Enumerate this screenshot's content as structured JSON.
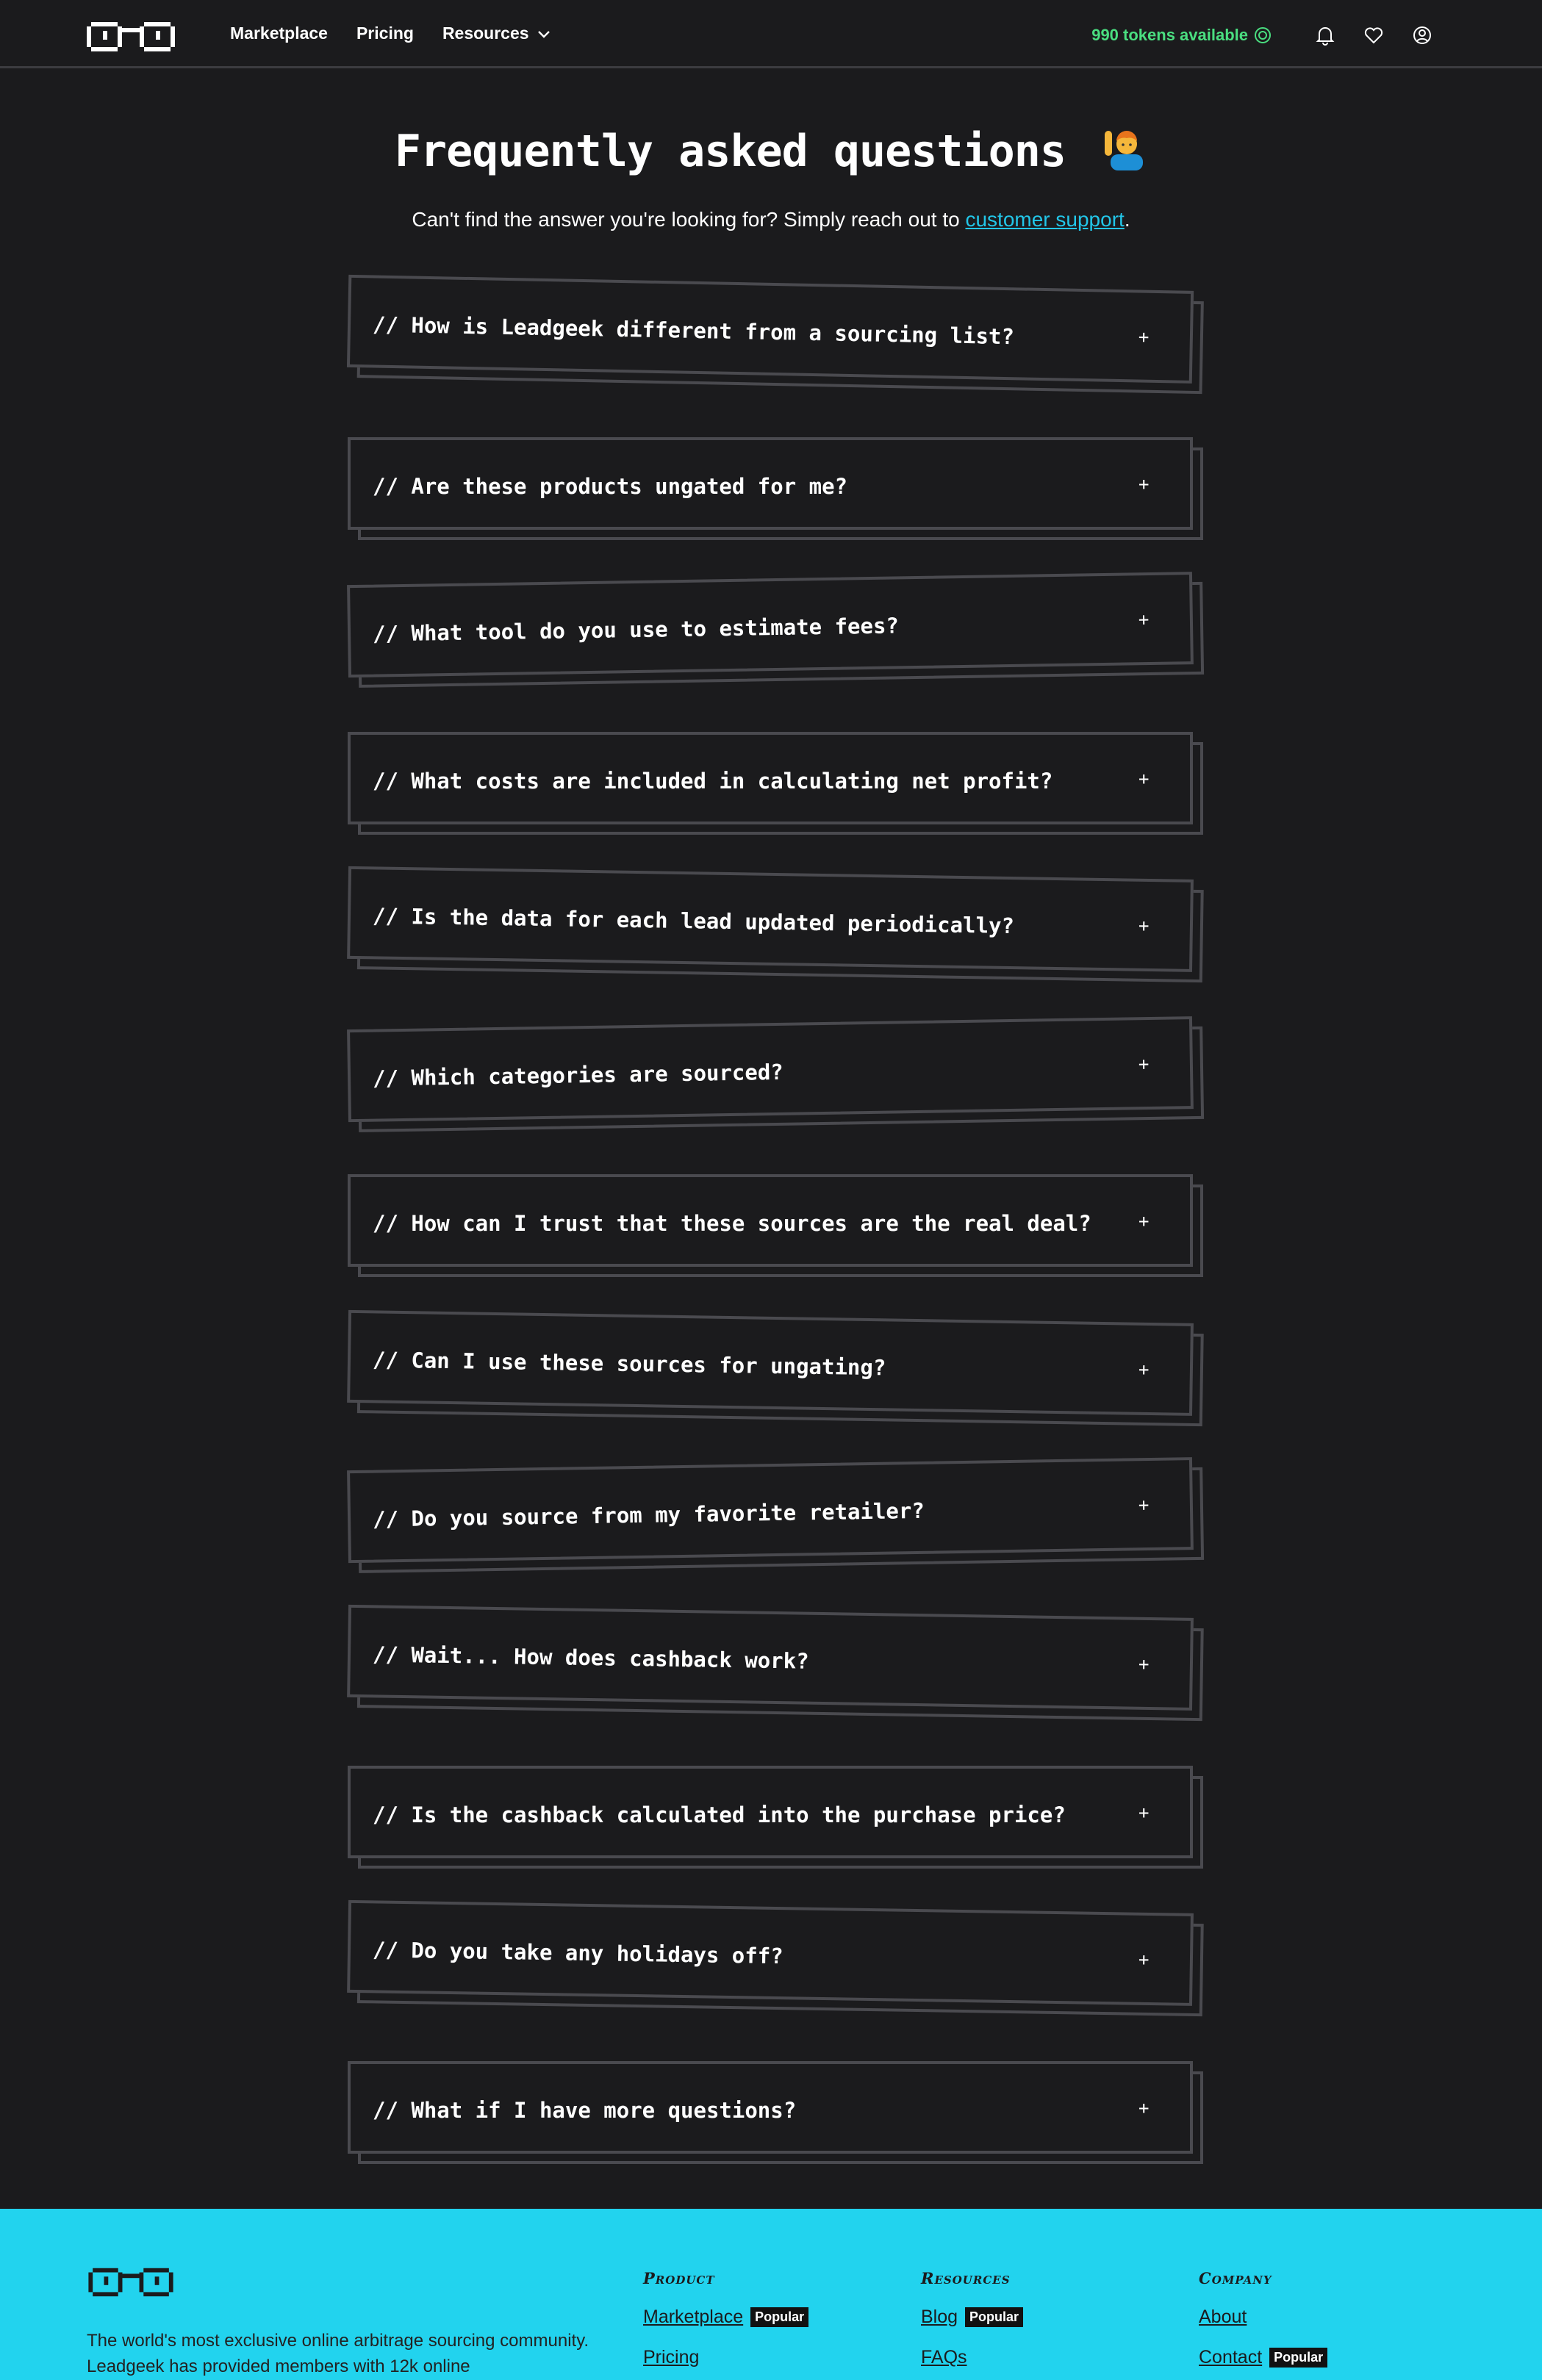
{
  "nav": {
    "links": [
      "Marketplace",
      "Pricing",
      "Resources"
    ],
    "tokens": "990 tokens available",
    "accent": "#4ade80"
  },
  "header": {
    "title": "Frequently asked questions",
    "subtitle_before": "Can't find the answer you're looking for? Simply reach out to ",
    "subtitle_link": "customer support",
    "subtitle_after": "."
  },
  "faqs": [
    "// How is Leadgeek different from a sourcing list?",
    "// Are these products ungated for me?",
    "// What tool do you use to estimate fees?",
    "// What costs are included in calculating net profit?",
    "// Is the data for each lead updated periodically?",
    "// Which categories are sourced?",
    "// How can I trust that these sources are the real deal?",
    "// Can I use these sources for ungating?",
    "// Do you source from my favorite retailer?",
    "// Wait... How does cashback work?",
    "// Is the cashback calculated into the purchase price?",
    "// Do you take any holidays off?",
    "// What if I have more questions?"
  ],
  "faq_toggle": "+",
  "footer": {
    "description": "The world's most exclusive online arbitrage sourcing community. Leadgeek has provided members with 12k online",
    "columns": [
      {
        "heading": "Product",
        "links": [
          {
            "label": "Marketplace",
            "badge": "Popular"
          },
          {
            "label": "Pricing",
            "badge": ""
          }
        ]
      },
      {
        "heading": "Resources",
        "links": [
          {
            "label": "Blog",
            "badge": "Popular"
          },
          {
            "label": "FAQs",
            "badge": ""
          }
        ]
      },
      {
        "heading": "Company",
        "links": [
          {
            "label": "About",
            "badge": ""
          },
          {
            "label": "Contact",
            "badge": "Popular"
          }
        ]
      }
    ],
    "bg": "#22d3ee"
  }
}
